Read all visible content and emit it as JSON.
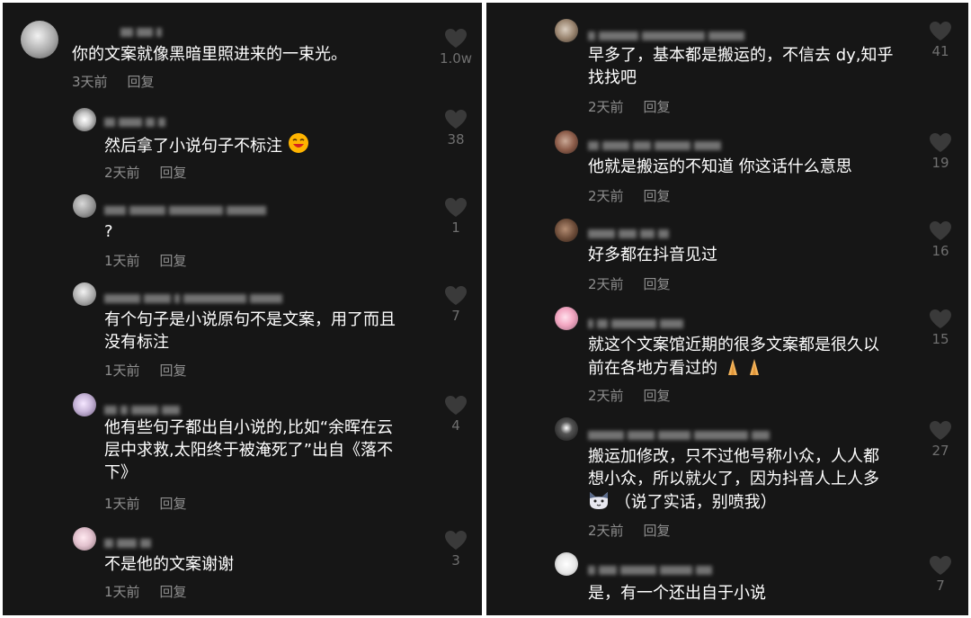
{
  "left_panel": {
    "comments": [
      {
        "text_lines": [
          "你的文案就像黑暗里照进来的一束光。"
        ],
        "time": "3天前",
        "reply": "回复",
        "likes": "1.0w"
      },
      {
        "text_lines": [
          "然后拿了小说句子不标注"
        ],
        "time": "2天前",
        "reply": "回复",
        "likes": "38",
        "emoji": "laughing-face-emoji"
      },
      {
        "text_lines": [
          "?"
        ],
        "time": "1天前",
        "reply": "回复",
        "likes": "1"
      },
      {
        "text_lines": [
          "有个句子是小说原句不是文案，用了而且",
          "没有标注"
        ],
        "time": "1天前",
        "reply": "回复",
        "likes": "7"
      },
      {
        "text_lines": [
          "他有些句子都出自小说的,比如“余晖在云",
          "层中求救,太阳终于被淹死了”出自《落不",
          "下》"
        ],
        "time": "1天前",
        "reply": "回复",
        "likes": "4"
      },
      {
        "text_lines": [
          "不是他的文案谢谢"
        ],
        "time": "1天前",
        "reply": "回复",
        "likes": "3"
      }
    ]
  },
  "right_panel": {
    "comments": [
      {
        "text_lines": [
          "早多了，基本都是搬运的，不信去 dy,知乎",
          "找找吧"
        ],
        "time": "2天前",
        "reply": "回复",
        "likes": "41"
      },
      {
        "text_lines": [
          "他就是搬运的不知道 你这话什么意思"
        ],
        "time": "2天前",
        "reply": "回复",
        "likes": "19"
      },
      {
        "text_lines": [
          "好多都在抖音见过"
        ],
        "time": "2天前",
        "reply": "回复",
        "likes": "16"
      },
      {
        "text_lines": [
          "就这个文案馆近期的很多文案都是很久以",
          "前在各地方看过的"
        ],
        "time": "2天前",
        "reply": "回复",
        "likes": "15",
        "emoji": "praying-hands-emoji"
      },
      {
        "text_lines": [
          "搬运加修改，只不过他号称小众，人人都",
          "想小众，所以就火了，因为抖音人上人多",
          "（说了实话，别喷我）"
        ],
        "time": "2天前",
        "reply": "回复",
        "likes": "27",
        "emoji": "cat-face-emoji"
      },
      {
        "text_lines": [
          "是，有一个还出自于小说"
        ],
        "likes": "7"
      }
    ]
  },
  "colors": {
    "background": "#161616",
    "text": "#ffffff",
    "meta": "#8e8e8e",
    "heart": "#3a3a3a",
    "like_count": "#6f6f6f"
  }
}
